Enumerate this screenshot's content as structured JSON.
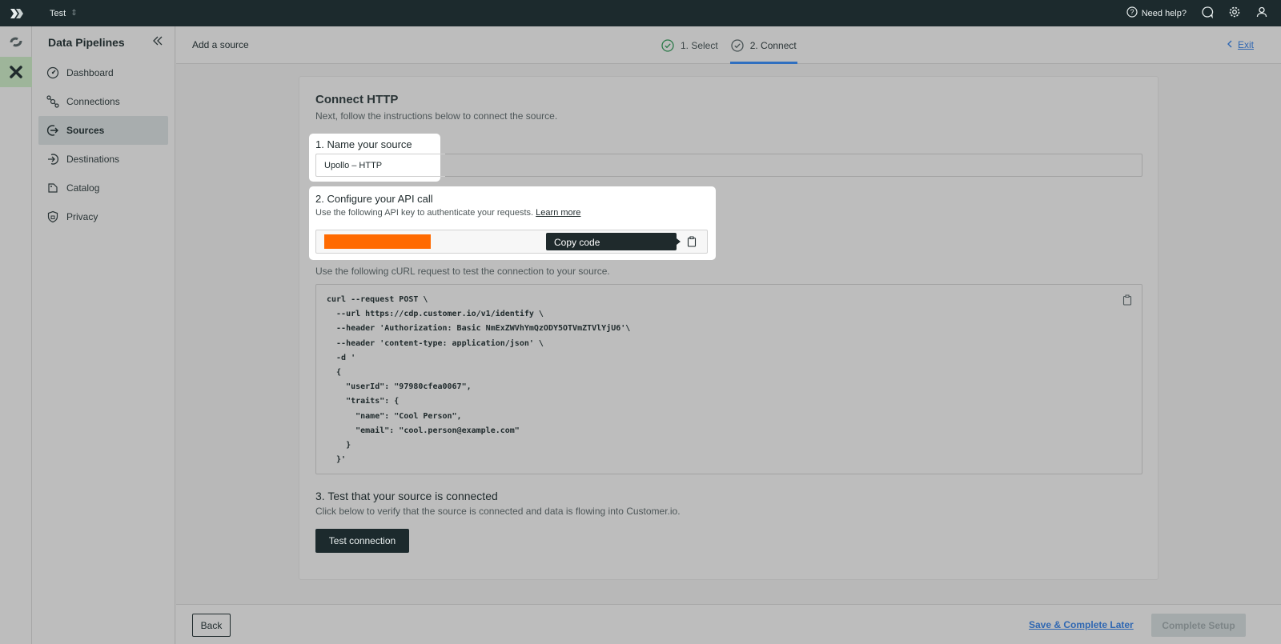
{
  "topbar": {
    "workspace": "Test",
    "help_label": "Need help?"
  },
  "sidebar": {
    "title": "Data Pipelines",
    "items": [
      {
        "label": "Dashboard",
        "icon": "dashboard-icon"
      },
      {
        "label": "Connections",
        "icon": "connections-icon"
      },
      {
        "label": "Sources",
        "icon": "sources-icon",
        "active": true
      },
      {
        "label": "Destinations",
        "icon": "destinations-icon"
      },
      {
        "label": "Catalog",
        "icon": "catalog-icon"
      },
      {
        "label": "Privacy",
        "icon": "privacy-icon"
      }
    ]
  },
  "header": {
    "title": "Add a source",
    "steps": [
      {
        "label": "1. Select",
        "state": "done"
      },
      {
        "label": "2. Connect",
        "state": "active"
      }
    ],
    "exit_label": "Exit"
  },
  "card": {
    "title": "Connect HTTP",
    "subtitle": "Next, follow the instructions below to connect the source.",
    "step1": {
      "label": "1. Name your source",
      "value": "Upollo – HTTP"
    },
    "step2": {
      "label": "2. Configure your API call",
      "hint": "Use the following API key to authenticate your requests.",
      "learn_more": "Learn more",
      "tooltip": "Copy code"
    },
    "curl_hint": "Use the following cURL request to test the connection to your source.",
    "curl_code": "curl --request POST \\\n  --url https://cdp.customer.io/v1/identify \\\n  --header 'Authorization: Basic NmExZWVhYmQzODY5OTVmZTVlYjU6'\\\n  --header 'content-type: application/json' \\\n  -d '\n  {\n    \"userId\": \"97980cfea0067\",\n    \"traits\": {\n      \"name\": \"Cool Person\",\n      \"email\": \"cool.person@example.com\"\n    }\n  }'",
    "step3": {
      "label": "3. Test that your source is connected",
      "hint": "Click below to verify that the source is connected and data is flowing into Customer.io.",
      "button": "Test connection"
    }
  },
  "footer": {
    "back": "Back",
    "save_later": "Save & Complete Later",
    "complete": "Complete Setup"
  },
  "colors": {
    "topbar": "#1c2a2d",
    "accent_blue": "#2f67b2",
    "redaction": "#ff6a00",
    "active_app": "#9eb59a"
  }
}
